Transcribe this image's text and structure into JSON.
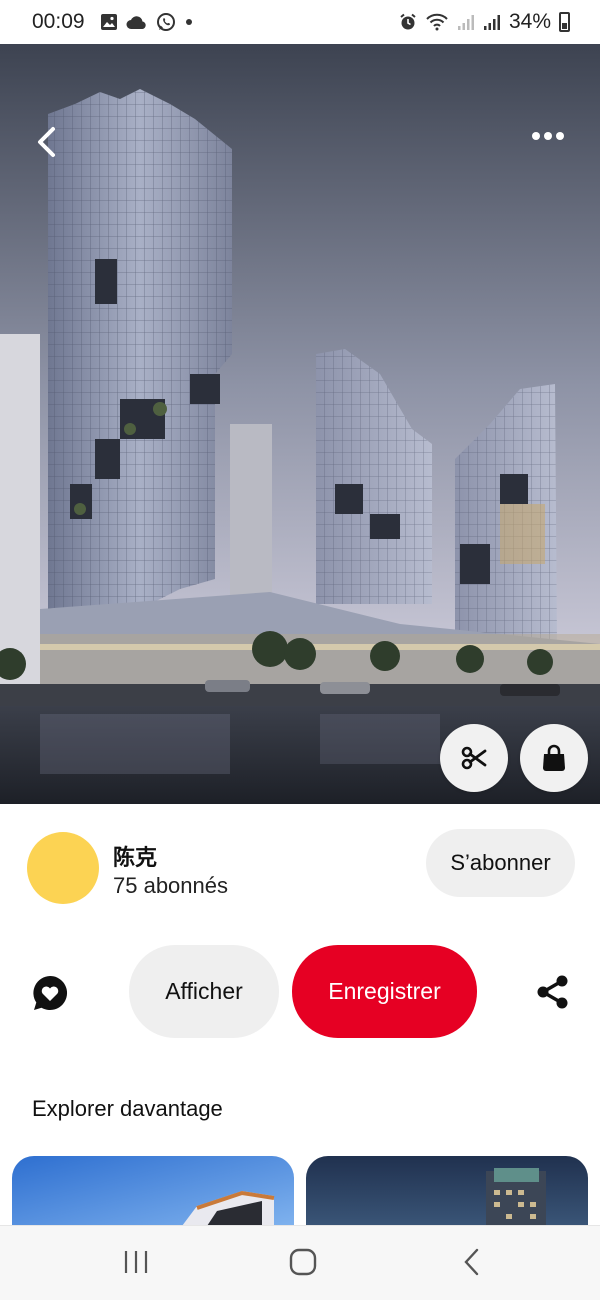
{
  "status_bar": {
    "time": "00:09",
    "battery": "34%",
    "left_icons": [
      "gallery-icon",
      "cloud-icon",
      "whatsapp-icon",
      "dot-icon"
    ],
    "right_icons": [
      "alarm-icon",
      "wifi-icon",
      "signal-icon",
      "signal-icon",
      "battery-icon"
    ]
  },
  "pin": {
    "image_icon_buttons": [
      "back-icon",
      "more-icon",
      "scissors-icon",
      "bag-icon"
    ]
  },
  "creator": {
    "name": "陈克",
    "followers": "75 abonnés",
    "avatar_color": "#fcd353",
    "follow_label": "S’abonner"
  },
  "actions": {
    "view_label": "Afficher",
    "save_label": "Enregistrer",
    "save_color": "#e60023"
  },
  "explore": {
    "title": "Explorer davantage"
  },
  "nav": {
    "buttons": [
      "recents-icon",
      "home-icon",
      "back-icon"
    ]
  }
}
